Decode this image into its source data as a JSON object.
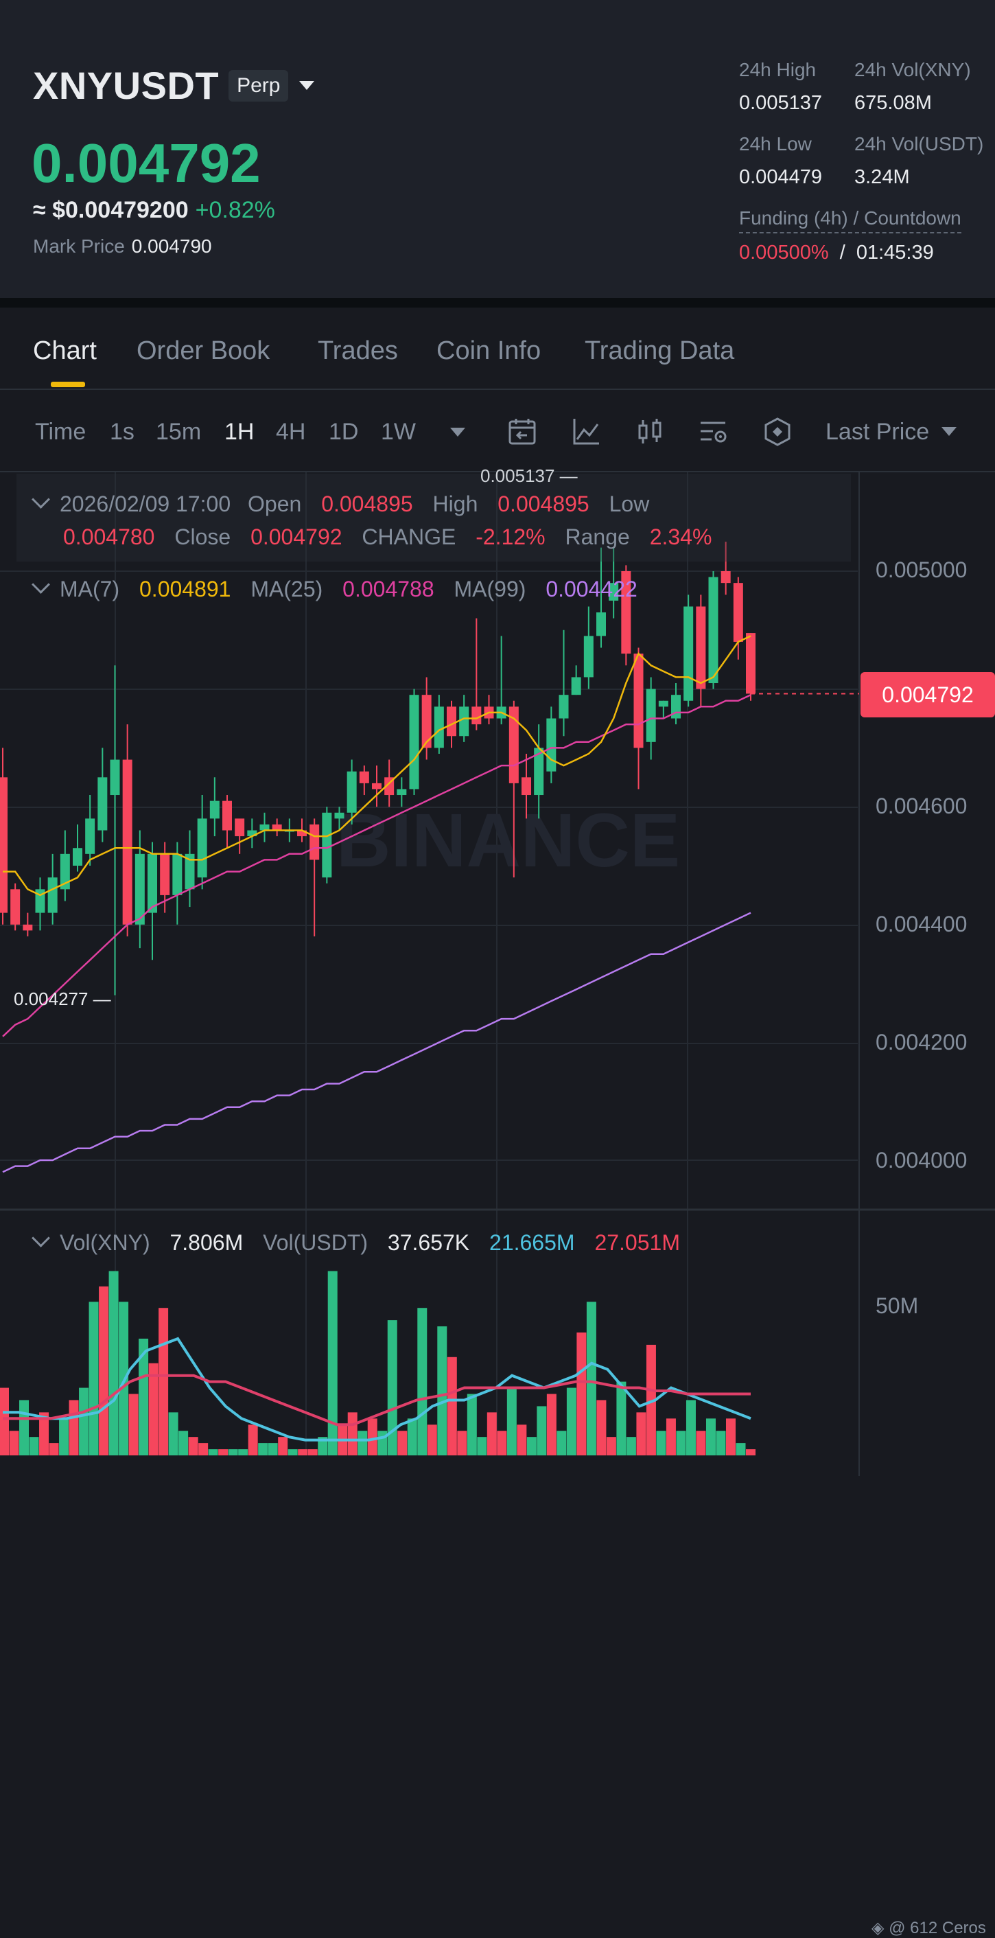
{
  "header": {
    "symbol": "XNYUSDT",
    "contract_type": "Perp",
    "last_price": "0.004792",
    "usd_price": "≈ $0.00479200",
    "change_pct": "+0.82%",
    "mark_price_label": "Mark Price",
    "mark_price": "0.004790",
    "stats": {
      "high_label": "24h High",
      "high": "0.005137",
      "vol_base_label": "24h Vol(XNY)",
      "vol_base": "675.08M",
      "low_label": "24h Low",
      "low": "0.004479",
      "vol_quote_label": "24h Vol(USDT)",
      "vol_quote": "3.24M",
      "funding_label": "Funding (4h) / Countdown",
      "funding_rate": "0.00500%",
      "funding_sep": "/",
      "countdown": "01:45:39"
    }
  },
  "tabs": [
    {
      "label": "Chart",
      "active": true
    },
    {
      "label": "Order Book",
      "active": false
    },
    {
      "label": "Trades",
      "active": false
    },
    {
      "label": "Coin Info",
      "active": false
    },
    {
      "label": "Trading Data",
      "active": false
    }
  ],
  "toolbar": {
    "timeframes": [
      {
        "label": "Time",
        "active": false
      },
      {
        "label": "1s",
        "active": false
      },
      {
        "label": "15m",
        "active": false
      },
      {
        "label": "1H",
        "active": true
      },
      {
        "label": "4H",
        "active": false
      },
      {
        "label": "1D",
        "active": false
      },
      {
        "label": "1W",
        "active": false
      }
    ],
    "icons": [
      "calendar-icon",
      "line-chart-icon",
      "candlestick-icon",
      "settings-icon",
      "indicator-icon"
    ],
    "price_type": "Last Price"
  },
  "ohlc": {
    "datetime": "2026/02/09 17:00",
    "open_label": "Open",
    "open": "0.004895",
    "high_label": "High",
    "high": "0.004895",
    "low_label": "Low",
    "low": "0.004780",
    "close_label": "Close",
    "close": "0.004792",
    "change_label": "CHANGE",
    "change": "-2.12%",
    "range_label": "Range",
    "range": "2.34%"
  },
  "ma": {
    "ma7_label": "MA(7)",
    "ma7": "0.004891",
    "ma25_label": "MA(25)",
    "ma25": "0.004788",
    "ma99_label": "MA(99)",
    "ma99": "0.004422"
  },
  "markers": {
    "high": "0.005137",
    "low": "0.004277"
  },
  "current_price_tag": "0.004792",
  "watermark": "BINANCE",
  "volume": {
    "base_label": "Vol(XNY)",
    "base": "7.806M",
    "quote_label": "Vol(USDT)",
    "quote": "37.657K",
    "ma_a": "21.665M",
    "ma_b": "27.051M",
    "axis_tick": "50M"
  },
  "footer": "@ 612 Ceros",
  "colors": {
    "up": "#2ebd85",
    "down": "#f6465d",
    "ma7": "#f0b90b",
    "ma25": "#e040a0",
    "ma99": "#b87cf0",
    "vol_ma_a": "#4fc3e0",
    "vol_ma_b": "#e0406a",
    "accent": "#f0b90b"
  },
  "chart_data": {
    "type": "candlestick",
    "interval": "1H",
    "ylim": [
      0.0039,
      0.00515
    ],
    "yticks": [
      "0.005000",
      "0.004600",
      "0.004400",
      "0.004200",
      "0.004000"
    ],
    "candles": [
      [
        0.00465,
        0.00442,
        0.0047,
        0.0044
      ],
      [
        0.00446,
        0.0044,
        0.00447,
        0.00439
      ],
      [
        0.0044,
        0.00439,
        0.00442,
        0.00438
      ],
      [
        0.00442,
        0.00446,
        0.00448,
        0.00439
      ],
      [
        0.00442,
        0.00448,
        0.00452,
        0.0044
      ],
      [
        0.00446,
        0.00452,
        0.00456,
        0.00444
      ],
      [
        0.0045,
        0.00453,
        0.00457,
        0.00449
      ],
      [
        0.00452,
        0.00458,
        0.00462,
        0.0045
      ],
      [
        0.00456,
        0.00465,
        0.0047,
        0.00454
      ],
      [
        0.00462,
        0.00468,
        0.00484,
        0.00428
      ],
      [
        0.00468,
        0.0044,
        0.00474,
        0.00438
      ],
      [
        0.0044,
        0.00452,
        0.00456,
        0.00436
      ],
      [
        0.00442,
        0.00452,
        0.00454,
        0.00434
      ],
      [
        0.00452,
        0.00445,
        0.00454,
        0.00442
      ],
      [
        0.00445,
        0.00452,
        0.00454,
        0.0044
      ],
      [
        0.00446,
        0.00452,
        0.00456,
        0.00443
      ],
      [
        0.00448,
        0.00458,
        0.00462,
        0.00446
      ],
      [
        0.00458,
        0.00461,
        0.00465,
        0.00455
      ],
      [
        0.00461,
        0.00456,
        0.00462,
        0.00453
      ],
      [
        0.00458,
        0.00455,
        0.00457,
        0.00452
      ],
      [
        0.00455,
        0.00456,
        0.00458,
        0.00453
      ],
      [
        0.00456,
        0.00457,
        0.00459,
        0.00454
      ],
      [
        0.00457,
        0.00456,
        0.00458,
        0.00455
      ],
      [
        0.00456,
        0.00456,
        0.00458,
        0.00454
      ],
      [
        0.00456,
        0.00455,
        0.00458,
        0.00454
      ],
      [
        0.00457,
        0.00451,
        0.00458,
        0.00438
      ],
      [
        0.00448,
        0.00459,
        0.0046,
        0.00447
      ],
      [
        0.00458,
        0.00459,
        0.0046,
        0.00456
      ],
      [
        0.00459,
        0.00466,
        0.00468,
        0.00457
      ],
      [
        0.00466,
        0.00464,
        0.00467,
        0.00462
      ],
      [
        0.00464,
        0.00463,
        0.00467,
        0.0046
      ],
      [
        0.00465,
        0.00462,
        0.00468,
        0.0046
      ],
      [
        0.00462,
        0.00463,
        0.00465,
        0.0046
      ],
      [
        0.00463,
        0.00479,
        0.0048,
        0.00462
      ],
      [
        0.00479,
        0.0047,
        0.00482,
        0.00468
      ],
      [
        0.0047,
        0.00477,
        0.00479,
        0.00469
      ],
      [
        0.00477,
        0.00472,
        0.00478,
        0.0047
      ],
      [
        0.00472,
        0.00477,
        0.00479,
        0.00471
      ],
      [
        0.00477,
        0.00474,
        0.00492,
        0.00473
      ],
      [
        0.00477,
        0.00475,
        0.00479,
        0.00474
      ],
      [
        0.00475,
        0.00477,
        0.00489,
        0.00474
      ],
      [
        0.00477,
        0.00464,
        0.00478,
        0.00448
      ],
      [
        0.00465,
        0.00462,
        0.00469,
        0.00458
      ],
      [
        0.00462,
        0.0047,
        0.00474,
        0.00458
      ],
      [
        0.00466,
        0.00475,
        0.00477,
        0.00464
      ],
      [
        0.00475,
        0.00479,
        0.0049,
        0.00472
      ],
      [
        0.00479,
        0.00482,
        0.00484,
        0.00479
      ],
      [
        0.00482,
        0.00489,
        0.00494,
        0.0048
      ],
      [
        0.00489,
        0.00493,
        0.00504,
        0.00487
      ],
      [
        0.00495,
        0.00498,
        0.00504,
        0.00492
      ],
      [
        0.005,
        0.00486,
        0.00501,
        0.00484
      ],
      [
        0.00486,
        0.0047,
        0.00487,
        0.00463
      ],
      [
        0.00471,
        0.0048,
        0.00482,
        0.00468
      ],
      [
        0.00477,
        0.00478,
        0.00478,
        0.00475
      ],
      [
        0.00475,
        0.00479,
        0.00481,
        0.00474
      ],
      [
        0.00478,
        0.00494,
        0.00496,
        0.00477
      ],
      [
        0.00494,
        0.0048,
        0.00496,
        0.00477
      ],
      [
        0.00481,
        0.00499,
        0.005,
        0.0048
      ],
      [
        0.005,
        0.00498,
        0.00505,
        0.00496
      ],
      [
        0.00498,
        0.00488,
        0.00499,
        0.00485
      ],
      [
        0.004895,
        0.004792,
        0.004895,
        0.00478
      ]
    ],
    "ma7": [
      0.00449,
      0.00449,
      0.00446,
      0.00445,
      0.00446,
      0.00447,
      0.00448,
      0.00451,
      0.00452,
      0.00453,
      0.00453,
      0.00453,
      0.00452,
      0.00452,
      0.00452,
      0.00451,
      0.00451,
      0.00452,
      0.00453,
      0.00454,
      0.00455,
      0.00456,
      0.00456,
      0.00456,
      0.00456,
      0.00455,
      0.00455,
      0.00456,
      0.00458,
      0.0046,
      0.00462,
      0.00464,
      0.00466,
      0.00468,
      0.00471,
      0.00473,
      0.00474,
      0.00475,
      0.00475,
      0.00476,
      0.00476,
      0.00475,
      0.00473,
      0.0047,
      0.00468,
      0.00467,
      0.00468,
      0.00469,
      0.00471,
      0.00475,
      0.00481,
      0.00486,
      0.00484,
      0.00483,
      0.00482,
      0.00482,
      0.00481,
      0.00482,
      0.00485,
      0.00488,
      0.00489
    ],
    "ma25": [
      0.00421,
      0.00423,
      0.00424,
      0.00426,
      0.00428,
      0.0043,
      0.00432,
      0.00434,
      0.00436,
      0.00438,
      0.0044,
      0.00441,
      0.00443,
      0.00444,
      0.00445,
      0.00446,
      0.00447,
      0.00448,
      0.00449,
      0.00449,
      0.0045,
      0.00451,
      0.00451,
      0.00452,
      0.00452,
      0.00453,
      0.00453,
      0.00454,
      0.00455,
      0.00456,
      0.00457,
      0.00458,
      0.00459,
      0.0046,
      0.00461,
      0.00462,
      0.00463,
      0.00464,
      0.00465,
      0.00466,
      0.00467,
      0.00467,
      0.00468,
      0.00469,
      0.0047,
      0.0047,
      0.00471,
      0.00471,
      0.00472,
      0.00473,
      0.00474,
      0.00474,
      0.00475,
      0.00475,
      0.00476,
      0.00476,
      0.00477,
      0.00477,
      0.00478,
      0.00478,
      0.00479
    ],
    "ma99": [
      0.00398,
      0.00399,
      0.00399,
      0.004,
      0.004,
      0.00401,
      0.00402,
      0.00402,
      0.00403,
      0.00404,
      0.00404,
      0.00405,
      0.00405,
      0.00406,
      0.00406,
      0.00407,
      0.00407,
      0.00408,
      0.00409,
      0.00409,
      0.0041,
      0.0041,
      0.00411,
      0.00411,
      0.00412,
      0.00412,
      0.00413,
      0.00413,
      0.00414,
      0.00415,
      0.00415,
      0.00416,
      0.00417,
      0.00418,
      0.00419,
      0.0042,
      0.00421,
      0.00422,
      0.00422,
      0.00423,
      0.00424,
      0.00424,
      0.00425,
      0.00426,
      0.00427,
      0.00428,
      0.00429,
      0.0043,
      0.00431,
      0.00432,
      0.00433,
      0.00434,
      0.00435,
      0.00435,
      0.00436,
      0.00437,
      0.00438,
      0.00439,
      0.0044,
      0.00441,
      0.00442
    ],
    "volume_ylim": [
      0,
      80
    ],
    "volume_m": [
      22,
      8,
      18,
      6,
      14,
      4,
      12,
      18,
      22,
      50,
      55,
      60,
      50,
      20,
      38,
      30,
      48,
      14,
      8,
      6,
      4,
      2,
      2,
      2,
      2,
      10,
      4,
      4,
      6,
      2,
      2,
      2,
      6,
      60,
      10,
      14,
      8,
      12,
      8,
      44,
      8,
      12,
      48,
      10,
      42,
      32,
      8,
      20,
      6,
      14,
      8,
      22,
      10,
      6,
      16,
      20,
      8,
      22,
      40,
      50,
      18,
      6,
      24,
      6,
      14,
      36,
      8,
      12,
      8,
      18,
      8,
      12,
      8,
      12,
      4,
      2
    ],
    "volume_ma_a": [
      14,
      14,
      13,
      12,
      12,
      13,
      14,
      18,
      28,
      34,
      36,
      38,
      30,
      22,
      16,
      12,
      10,
      8,
      6,
      5,
      5,
      5,
      5,
      5,
      6,
      10,
      12,
      16,
      18,
      18,
      20,
      22,
      26,
      24,
      22,
      24,
      26,
      30,
      28,
      22,
      16,
      18,
      22,
      20,
      18,
      16,
      14,
      12
    ],
    "volume_ma_b": [
      12,
      12,
      12,
      12,
      13,
      14,
      16,
      20,
      24,
      26,
      26,
      26,
      26,
      24,
      24,
      22,
      20,
      18,
      16,
      14,
      12,
      10,
      10,
      12,
      14,
      16,
      18,
      19,
      20,
      22,
      22,
      22,
      22,
      22,
      22,
      23,
      24,
      24,
      23,
      22,
      22,
      21,
      21,
      20,
      20,
      20,
      20,
      20
    ]
  }
}
